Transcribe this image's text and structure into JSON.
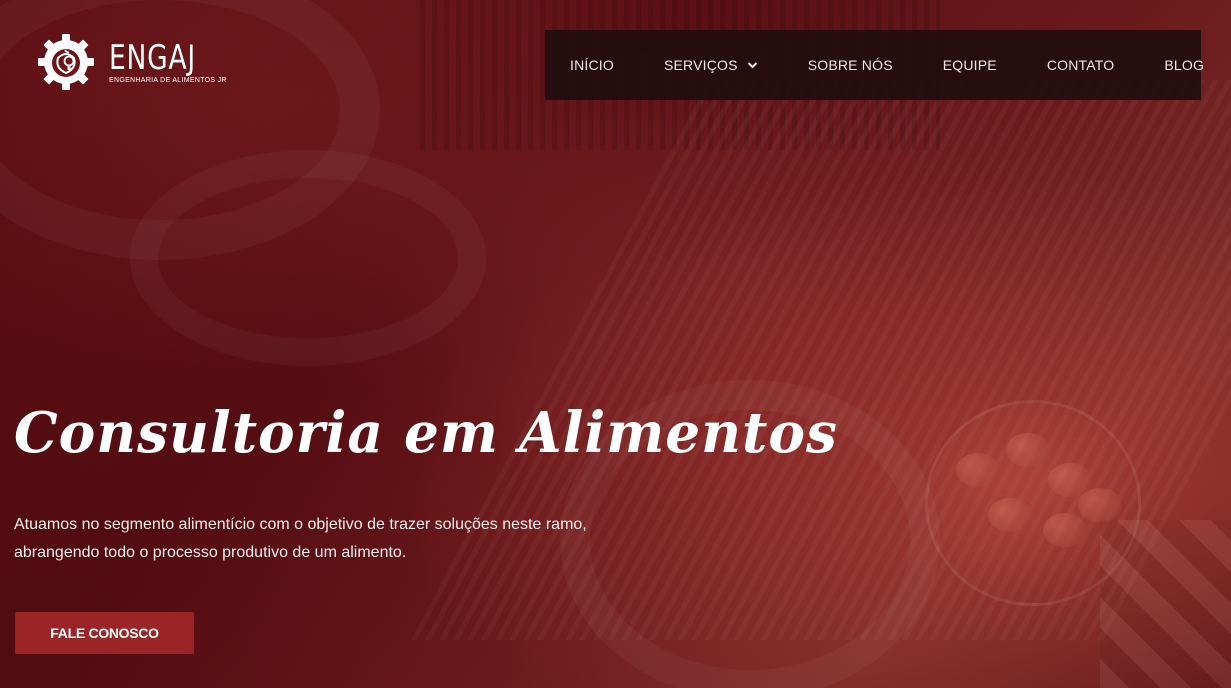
{
  "brand": {
    "name": "ENGAJ",
    "subtitle": "ENGENHARIA DE ALIMENTOS JR",
    "logo_icon": "gear-apple-bulb-icon"
  },
  "nav": {
    "items": [
      {
        "label": "INÍCIO"
      },
      {
        "label": "SERVIÇOS",
        "icon": "chevron-down-icon"
      },
      {
        "label": "SOBRE NÓS"
      },
      {
        "label": "EQUIPE"
      },
      {
        "label": "CONTATO"
      },
      {
        "label": "BLOG"
      }
    ]
  },
  "hero": {
    "title": "Consultoria em Alimentos",
    "description": "Atuamos no segmento alimentício com o objetivo de trazer soluções neste ramo, abrangendo todo o processo produtivo de um alimento.",
    "cta_label": "FALE CONOSCO"
  },
  "colors": {
    "background": "#6e1418",
    "nav_background": "#1e0c0e",
    "cta": "#9b2427",
    "text": "#ffffff"
  }
}
